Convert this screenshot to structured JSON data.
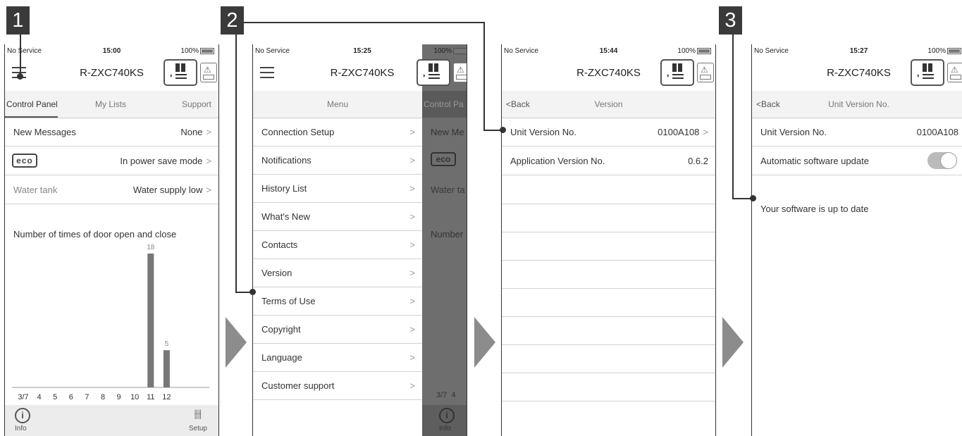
{
  "steps": [
    "1",
    "2",
    "3"
  ],
  "status": {
    "carrier": "No Service",
    "battery": "100%",
    "times": [
      "15:00",
      "15:25",
      "15:44",
      "15:27"
    ]
  },
  "model": "R-ZXC740KS",
  "screen1": {
    "tabs": [
      "Control Panel",
      "My Lists",
      "Support"
    ],
    "rows": [
      {
        "label": "New Messages",
        "value": "None"
      },
      {
        "label": "eco",
        "value": "In power save mode"
      },
      {
        "label": "Water tank",
        "value": "Water supply low"
      }
    ],
    "chart_data": {
      "type": "bar",
      "title": "Number of times of door open and close",
      "categories": [
        "3/7",
        "4",
        "5",
        "6",
        "7",
        "8",
        "9",
        "10",
        "11",
        "12"
      ],
      "values": [
        0,
        0,
        0,
        0,
        0,
        0,
        0,
        0,
        18,
        5
      ],
      "value_labels": [
        "",
        "",
        "",
        "",
        "",
        "",
        "",
        "",
        "18",
        "5"
      ],
      "xlabel": "",
      "ylabel": "",
      "ylim": [
        0,
        18
      ]
    },
    "bottom": {
      "info": "Info",
      "setup": "Setup"
    }
  },
  "screen2": {
    "menu_title": "Menu",
    "items": [
      "Connection Setup",
      "Notifications",
      "History List",
      "What's New",
      "Contacts",
      "Version",
      "Terms of Use",
      "Copyright",
      "Language",
      "Customer support"
    ],
    "behind_tab": "Control Pa",
    "behind_rows": [
      "New Me",
      "Water ta",
      "Number"
    ],
    "behind_axis": "3/7",
    "behind_axis2": "4",
    "behind_info": "Info"
  },
  "screen3": {
    "back": "Back",
    "title": "Version",
    "rows": [
      {
        "label": "Unit Version No.",
        "value": "0100A108"
      },
      {
        "label": "Application Version No.",
        "value": "0.6.2"
      }
    ]
  },
  "screen4": {
    "back": "Back",
    "title": "Unit Version No.",
    "unit_label": "Unit Version No.",
    "unit_value": "0100A108",
    "auto_update": "Automatic software update",
    "up_to_date": "Your software is up to date"
  }
}
